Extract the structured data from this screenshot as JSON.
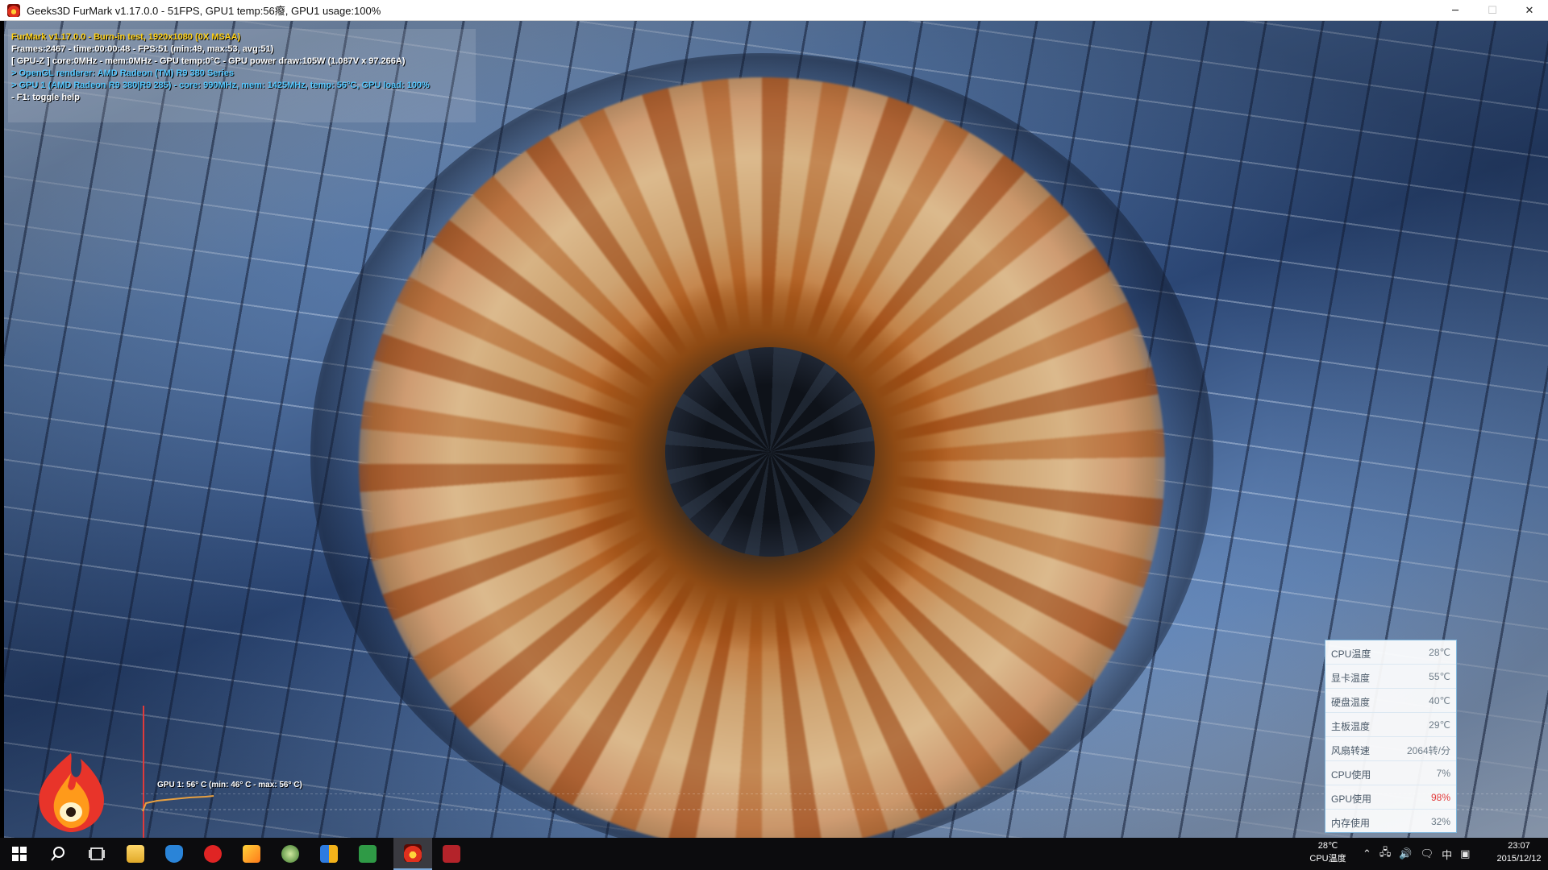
{
  "window": {
    "title": "Geeks3D FurMark v1.17.0.0 - 51FPS, GPU1 temp:56癈, GPU1 usage:100%",
    "controls": {
      "minimize": "─",
      "maximize": "☐",
      "close": "✕"
    }
  },
  "osd": {
    "lines": [
      {
        "text": "FurMark v1.17.0.0 - Burn-in test, 1920x1080 (0X MSAA)",
        "color": "#ffd21a"
      },
      {
        "text": "Frames:2467 - time:00:00:48 - FPS:51 (min:49, max:53, avg:51)",
        "color": "#ffffff"
      },
      {
        "text": "[ GPU-Z ] core:0MHz - mem:0MHz - GPU temp:0°C - GPU power draw:105W (1.087V x 97.266A)",
        "color": "#ffffff"
      },
      {
        "text": "> OpenGL renderer: AMD Radeon (TM) R9 380 Series",
        "color": "#56c8ff"
      },
      {
        "text": "> GPU 1 (AMD Radeon R9 380|R9 285) - core: 990MHz, mem: 1425MHz, temp: 56°C, GPU load: 100%",
        "color": "#56c8ff"
      },
      {
        "text": "- F1: toggle help",
        "color": "#ffffff"
      }
    ]
  },
  "graph": {
    "label": "GPU 1: 56° C (min: 46° C - max: 56° C)",
    "color": "#e8a040"
  },
  "sensors": [
    {
      "label": "CPU温度",
      "value": "28℃",
      "alert": false
    },
    {
      "label": "显卡温度",
      "value": "55℃",
      "alert": false
    },
    {
      "label": "硬盘温度",
      "value": "40℃",
      "alert": false
    },
    {
      "label": "主板温度",
      "value": "29℃",
      "alert": false
    },
    {
      "label": "风扇转速",
      "value": "2064转/分",
      "alert": false
    },
    {
      "label": "CPU使用",
      "value": "7%",
      "alert": false
    },
    {
      "label": "GPU使用",
      "value": "98%",
      "alert": true
    },
    {
      "label": "内存使用",
      "value": "32%",
      "alert": false
    }
  ],
  "taskbar": {
    "tray_temp_value": "28℃",
    "tray_temp_label": "CPU温度",
    "ime": "中",
    "time": "23:07",
    "date": "2015/12/12"
  }
}
